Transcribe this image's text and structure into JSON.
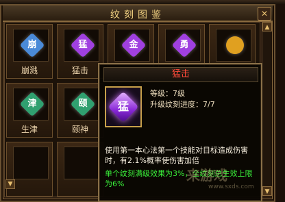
{
  "window": {
    "title": "纹刻图鉴",
    "close_glyph": "✕"
  },
  "grid_items": [
    {
      "name": "崩溅",
      "glyph": "崩",
      "color": "#4a8ad8"
    },
    {
      "name": "猛击",
      "glyph": "猛",
      "color": "#a040e0"
    },
    {
      "name": "",
      "glyph": "金",
      "color": "#a040e0"
    },
    {
      "name": "",
      "glyph": "勇",
      "color": "#a040e0"
    },
    {
      "name": "",
      "glyph": "",
      "color": "#e0a020"
    },
    {
      "name": "生津",
      "glyph": "津",
      "color": "#30a070"
    },
    {
      "name": "颐神",
      "glyph": "颐",
      "color": "#30a070"
    }
  ],
  "tooltip": {
    "title": "猛击",
    "icon_glyph": "猛",
    "level_line": "等级：7级",
    "progress_line": "升级纹刻进度：7/7",
    "description": "使用第一本心法第一个技能对目标造成伤害时，有2.1%概率使伤害加倍",
    "bonus": "单个纹刻满级效果为3%，全纹刻总生效上限为6%"
  },
  "watermark": {
    "text": "来游戏",
    "url": "www.sxds.com"
  }
}
